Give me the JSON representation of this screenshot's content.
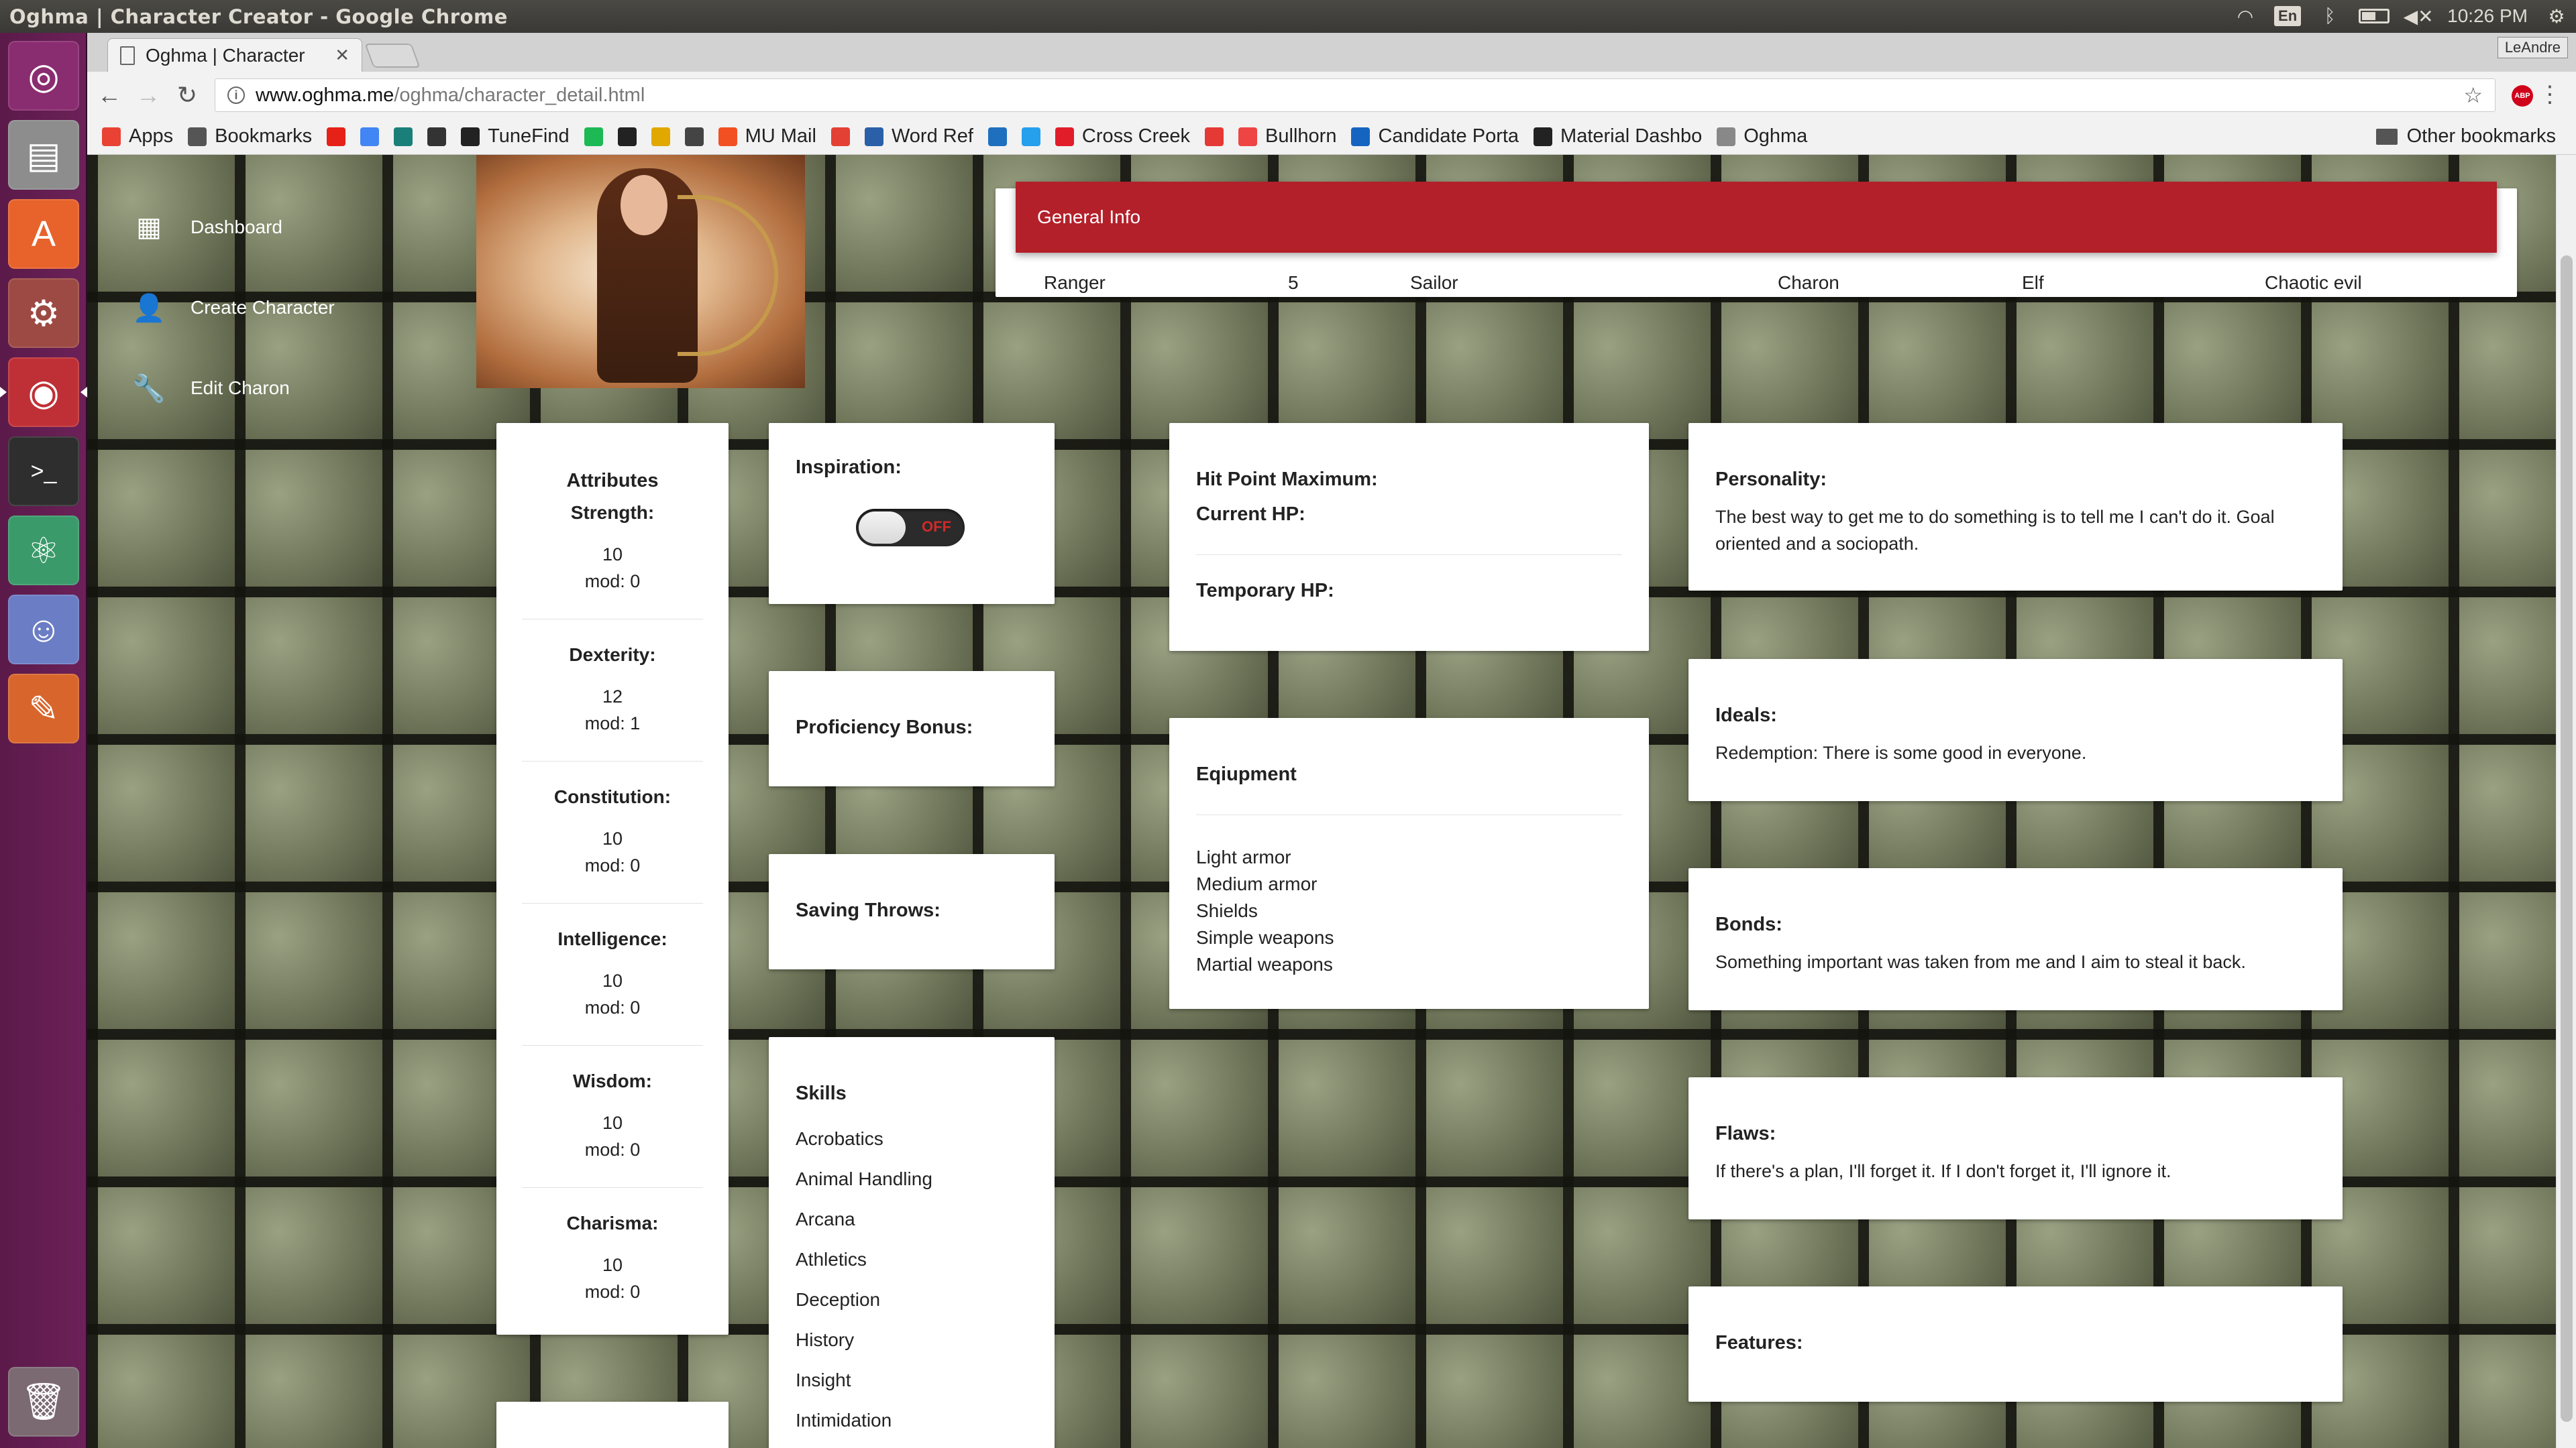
{
  "os": {
    "window_title": "Oghma | Character Creator - Google Chrome",
    "keyboard_layout": "En",
    "clock": "10:26 PM",
    "launcher": [
      "ubuntu-dash-icon",
      "files-icon",
      "software-center-icon",
      "settings-icon",
      "chrome-icon",
      "terminal-icon",
      "atom-icon",
      "discord-icon",
      "editor-icon",
      "trash-icon"
    ]
  },
  "browser": {
    "tab_title": "Oghma | Character",
    "user": "LeAndre",
    "url_host": "www.oghma.me",
    "url_path": "/oghma/character_detail.html",
    "bookmarks": [
      {
        "label": "Apps",
        "color": "#e94235"
      },
      {
        "label": "Bookmarks",
        "color": "#555555"
      },
      {
        "label": "",
        "color": "#e62117"
      },
      {
        "label": "",
        "color": "#4285f4"
      },
      {
        "label": "",
        "color": "#1b7f79"
      },
      {
        "label": "",
        "color": "#333333"
      },
      {
        "label": "TuneFind",
        "color": "#222222"
      },
      {
        "label": "",
        "color": "#1db954"
      },
      {
        "label": "",
        "color": "#222222"
      },
      {
        "label": "",
        "color": "#e0a800"
      },
      {
        "label": "",
        "color": "#444444"
      },
      {
        "label": "MU Mail",
        "color": "#f25022"
      },
      {
        "label": "",
        "color": "#e34133"
      },
      {
        "label": "Word Ref",
        "color": "#2b5fa8"
      },
      {
        "label": "",
        "color": "#1f6fbf"
      },
      {
        "label": "",
        "color": "#24a0ed"
      },
      {
        "label": "Cross Creek",
        "color": "#e11d2a"
      },
      {
        "label": "",
        "color": "#e53935"
      },
      {
        "label": "Bullhorn",
        "color": "#ef4444"
      },
      {
        "label": "Candidate Porta",
        "color": "#1565c0"
      },
      {
        "label": "Material Dashbo",
        "color": "#222222"
      },
      {
        "label": "Oghma",
        "color": "#888888"
      }
    ],
    "other_bookmarks": "Other bookmarks"
  },
  "nav": {
    "dashboard": "Dashboard",
    "create_character": "Create Character",
    "edit_character": "Edit Charon"
  },
  "general_info": {
    "header": "General Info",
    "class": "Ranger",
    "level": "5",
    "background": "Sailor",
    "name": "Charon",
    "race": "Elf",
    "alignment": "Chaotic evil"
  },
  "attributes": {
    "title": "Attributes",
    "items": [
      {
        "name": "Strength:",
        "value": "10",
        "mod": "mod: 0"
      },
      {
        "name": "Dexterity:",
        "value": "12",
        "mod": "mod: 1"
      },
      {
        "name": "Constitution:",
        "value": "10",
        "mod": "mod: 0"
      },
      {
        "name": "Intelligence:",
        "value": "10",
        "mod": "mod: 0"
      },
      {
        "name": "Wisdom:",
        "value": "10",
        "mod": "mod: 0"
      },
      {
        "name": "Charisma:",
        "value": "10",
        "mod": "mod: 0"
      }
    ]
  },
  "inspiration": {
    "label": "Inspiration:",
    "toggle_state": "OFF"
  },
  "proficiency": {
    "label": "Proficiency Bonus:"
  },
  "saving_throws": {
    "label": "Saving Throws:"
  },
  "skills": {
    "title": "Skills",
    "items": [
      "Acrobatics",
      "Animal Handling",
      "Arcana",
      "Athletics",
      "Deception",
      "History",
      "Insight",
      "Intimidation"
    ]
  },
  "hp": {
    "max_label": "Hit Point Maximum:",
    "current_label": "Current HP:",
    "temp_label": "Temporary HP:"
  },
  "equipment": {
    "title": "Eqiupment",
    "items": [
      "Light armor",
      "Medium armor",
      "Shields",
      "Simple weapons",
      "Martial weapons"
    ]
  },
  "personality": {
    "title": "Personality:",
    "text": "The best way to get me to do something is to tell me I can't do it. Goal oriented and a sociopath."
  },
  "ideals": {
    "title": "Ideals:",
    "text": "Redemption: There is some good in everyone."
  },
  "bonds": {
    "title": "Bonds:",
    "text": "Something important was taken from me and I aim to steal it back."
  },
  "flaws": {
    "title": "Flaws:",
    "text": "If there's a plan, I'll forget it. If I don't forget it, I'll ignore it."
  },
  "features": {
    "title": "Features:"
  }
}
